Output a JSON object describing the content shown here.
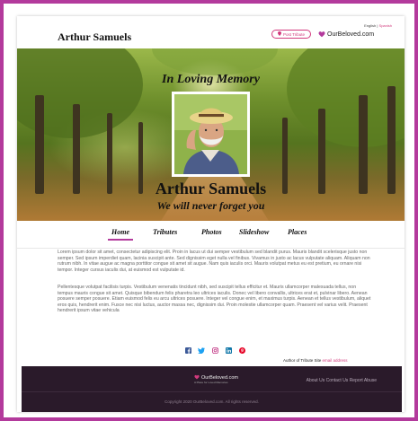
{
  "header": {
    "language_english": "English",
    "language_sep": " | ",
    "language_spanish": "Spanish",
    "site_name": "Arthur Samuels",
    "post_tribute_label": "Post Tribute",
    "logo_text": "OurBeloved.com"
  },
  "banner": {
    "memory_text": "In Loving Memory",
    "name": "Arthur Samuels",
    "subtitle": "We will never forget you"
  },
  "nav": {
    "items": [
      {
        "label": "Home",
        "active": true
      },
      {
        "label": "Tributes",
        "active": false
      },
      {
        "label": "Photos",
        "active": false
      },
      {
        "label": "Slideshow",
        "active": false
      },
      {
        "label": "Places",
        "active": false
      }
    ]
  },
  "content": {
    "paragraphs": [
      "Lorem ipsum dolor sit amet, consectetur adipiscing elit. Proin in lacus ut dui semper vestibulum sed blandit purus. Mauris blandit scelerisque justo non semper. Sed ipsum imperdiet quam, lacinia suscipit ante. Sed dignissim eget nulla vel finibus. Vivamus in justo ac lacus vulputate aliquam. Aliquam non rutrum nibh. In vitae augue ac magna porttitor congue sit amet sit augue. Nam quis iaculis orci. Mauris volutpat metus eu est pretium, eu ornare nisi tempor. Integer cursus iaculis dui, at euismod est vulputate id.",
      "Pellentesque volutpat facilisis turpis. Vestibulum venenatis tincidunt nibh, sed suscipit tellus efficitur et. Mauris ullamcorper malesuada tellus, non tempus mauris congue sit amet. Quisque bibendum felis pharetra leo ultrices iaculis. Donec vel libero convallis, ultrices erat et, pulvinar libero. Aenean posuere semper posuere. Etiam euismod felis eu arcu ultrices posuere. Integer vel congue enim, et maximus turpis. Aenean et tellus vestibulum, aliquet eros quis, hendrerit enim. Fusce nec nisi luctus, auctor massa nec, dignissim dui. Proin molestie ullamcorper quam. Praesent vel varius velit. Praesent hendrerit ipsum vitae vehicula"
    ]
  },
  "social": {
    "icons": [
      "facebook-icon",
      "twitter-icon",
      "instagram-icon",
      "linkedin-icon",
      "pinterest-icon"
    ],
    "author_label": "Author of Tribute Site",
    "author_email": "email address"
  },
  "footer": {
    "logo_text": "OurBeloved.com",
    "tagline": "A Place for Loved Memories",
    "links": "About Us  Contact Us  Report Abuse",
    "copyright": "Copyright 2020 OurBeloved.com. All rights reserved."
  },
  "colors": {
    "accent": "#b33a9c",
    "link": "#d23a7d",
    "footer_bg": "#2a1a2a"
  }
}
